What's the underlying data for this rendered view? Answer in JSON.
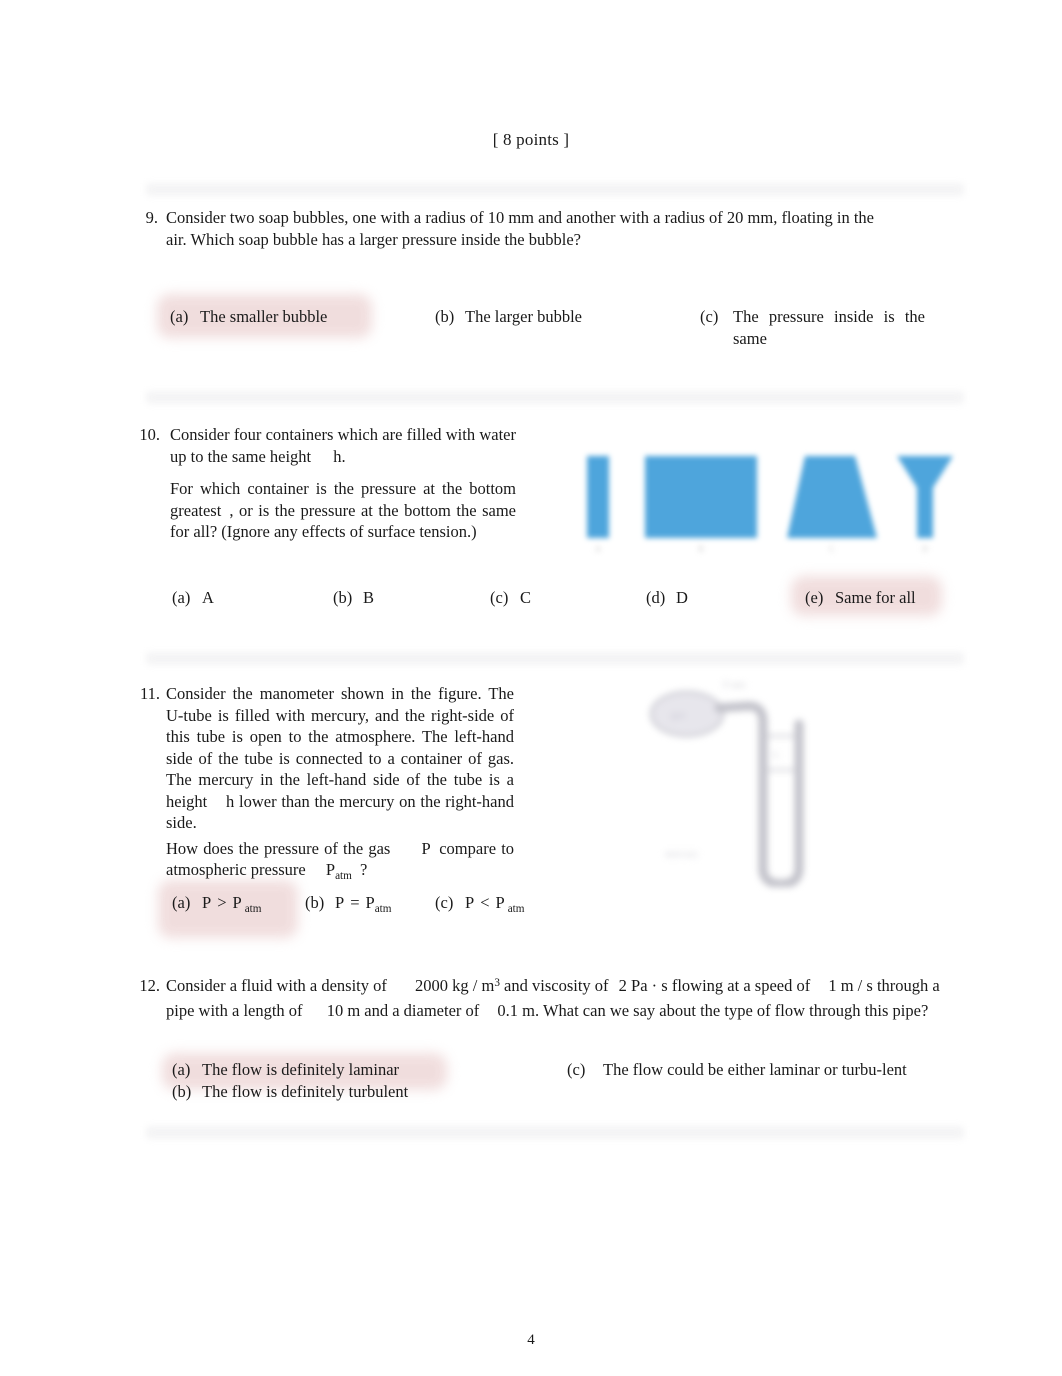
{
  "document": {
    "points_header": "[ 8 points ]",
    "page_number": "4",
    "accent_highlight": "#f0dcdc",
    "figure_blue": "#4ea5dc",
    "separator_color": "#f4f4f5"
  },
  "questions": [
    {
      "number": "9.",
      "text": "Consider two soap bubbles, one with a radius of 10 mm and another with a radius of 20 mm, floating in the air. Which soap bubble has a larger pressure inside the bubble?",
      "options": [
        {
          "label": "(a)",
          "text": "The smaller bubble",
          "highlighted": true
        },
        {
          "label": "(b)",
          "text": "The larger bubble",
          "highlighted": false
        },
        {
          "label": "(c)",
          "text": "The pressure inside is the same",
          "highlighted": false
        }
      ]
    },
    {
      "number": "10.",
      "text_part1": "Consider four containers which are filled with water up to the same height",
      "text_part1_var": "h",
      "text_part1_end": ".",
      "text_part2_a": "For which container is the pressure at the bottom greatest",
      "text_part2_b": ", or is the pressure at the bottom the same for all? (Ignore any effects of surface tension.)",
      "figure": {
        "name": "four-water-containers",
        "color": "#4ea5dc",
        "shapes": [
          {
            "id": "A",
            "kind": "narrow-rectangle"
          },
          {
            "id": "B",
            "kind": "wide-rectangle"
          },
          {
            "id": "C",
            "kind": "trapezoid-wide-bottom"
          },
          {
            "id": "D",
            "kind": "funnel"
          }
        ]
      },
      "options": [
        {
          "label": "(a)",
          "text": "A",
          "highlighted": false
        },
        {
          "label": "(b)",
          "text": "B",
          "highlighted": false
        },
        {
          "label": "(c)",
          "text": "C",
          "highlighted": false
        },
        {
          "label": "(d)",
          "text": "D",
          "highlighted": false
        },
        {
          "label": "(e)",
          "text": "Same for all",
          "highlighted": true
        }
      ]
    },
    {
      "number": "11.",
      "text_part1": "Consider the manometer shown in the figure. The U-tube is filled with mercury, and the right-side of this tube is open to the atmosphere. The left-hand side of the tube is connected to a container of gas. The mercury in the left-hand side of the tube is a height",
      "text_part1_var": "h",
      "text_part1_end": "lower than the mercury on the right-hand side.",
      "text_part2_a": "How does the pressure of the gas",
      "text_part2_var": "P",
      "text_part2_b": "compare to atmospheric pressure",
      "text_part2_var2": "P",
      "text_part2_var2_sub": "atm",
      "text_part2_end": "?",
      "figure": {
        "name": "u-tube-manometer"
      },
      "options": [
        {
          "label": "(a)",
          "p": "P",
          "rel": ">",
          "p2": "P",
          "p2sub": "atm",
          "highlighted": true
        },
        {
          "label": "(b)",
          "p": "P",
          "rel": "=",
          "p2": "P",
          "p2sub": "atm",
          "highlighted": false
        },
        {
          "label": "(c)",
          "p": "P",
          "rel": "<",
          "p2": "P",
          "p2sub": "atm",
          "highlighted": false
        }
      ]
    },
    {
      "number": "12.",
      "text_a": "Consider a fluid with a density of",
      "text_density": "2000 kg / m",
      "text_density_exp": "3",
      "text_b": "and viscosity of",
      "text_visc": "2 Pa · s",
      "text_c": "flowing at a speed of",
      "text_speed": "1 m / s",
      "text_d": "through a pipe with a length of",
      "text_length": "10 m",
      "text_e": "and a diameter of",
      "text_diam": "0.1 m.",
      "text_f": "What can we say about the type of flow through this pipe?",
      "options": [
        {
          "label": "(a)",
          "text": "The flow is definitely laminar",
          "highlighted": true
        },
        {
          "label": "(b)",
          "text": "The flow is definitely turbulent",
          "highlighted": false
        },
        {
          "label": "(c)",
          "text": "The flow could be either laminar or turbu-lent",
          "highlighted": false
        }
      ]
    }
  ]
}
